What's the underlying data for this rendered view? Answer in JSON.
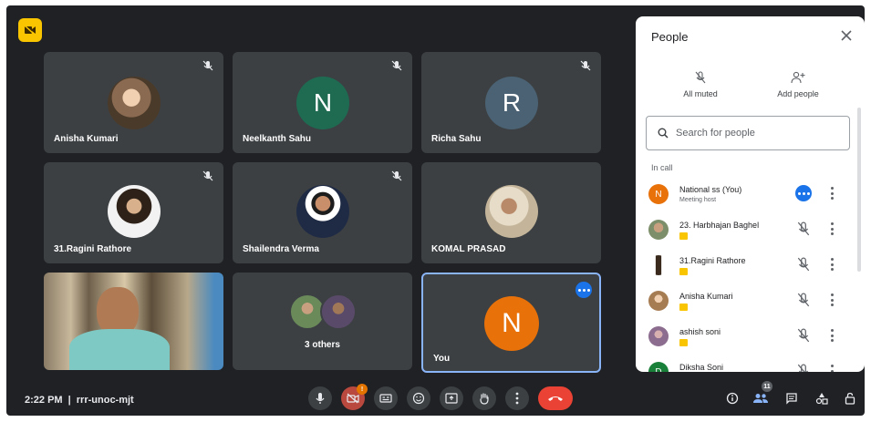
{
  "meeting": {
    "time": "2:22 PM",
    "separator": "|",
    "code": "rrr-unoc-mjt"
  },
  "tiles": [
    {
      "name": "Anisha Kumari",
      "avatar": "photo",
      "muted": true
    },
    {
      "name": "Neelkanth Sahu",
      "avatar": "letter",
      "initial": "N",
      "color": "#1e6b52",
      "muted": true
    },
    {
      "name": "Richa Sahu",
      "avatar": "letter",
      "initial": "R",
      "color": "#4a6273",
      "muted": true
    },
    {
      "name": "31.Ragini Rathore",
      "avatar": "photo",
      "muted": true
    },
    {
      "name": "Shailendra Verma",
      "avatar": "photo",
      "muted": true
    },
    {
      "name": "KOMAL PRASAD",
      "avatar": "photo",
      "muted": false
    },
    {
      "name": "",
      "avatar": "video",
      "muted": false
    },
    {
      "name": "3 others",
      "avatar": "group",
      "muted": false
    },
    {
      "name": "You",
      "avatar": "letter",
      "initial": "N",
      "color": "#e8710a",
      "muted": false,
      "selected": true
    }
  ],
  "controls": {
    "buttons": [
      "mic-icon",
      "camera-off-icon",
      "captions-icon",
      "emoji-icon",
      "present-icon",
      "raise-hand-icon",
      "more-vert-icon",
      "end-call-icon"
    ],
    "camera_badge": "!",
    "participant_count": "11",
    "right_icons": [
      "info-icon",
      "people-icon",
      "chat-icon",
      "activities-icon",
      "lock-icon"
    ]
  },
  "people_panel": {
    "title": "People",
    "actions": [
      {
        "label": "All muted",
        "icon": "mic-off-icon"
      },
      {
        "label": "Add people",
        "icon": "add-person-icon"
      }
    ],
    "search_placeholder": "Search for people",
    "section_label": "In call",
    "participants": [
      {
        "name": "National ss (You)",
        "subtitle": "Meeting host",
        "initial": "N",
        "color": "#e8710a",
        "status": "host-options"
      },
      {
        "name": "23. Harbhajan Baghel",
        "subtitle": "",
        "color": "#7d8f6a",
        "status": "muted"
      },
      {
        "name": "31.Ragini Rathore",
        "subtitle": "",
        "color": "#5a4a3a",
        "status": "muted"
      },
      {
        "name": "Anisha Kumari",
        "subtitle": "",
        "color": "#a67c52",
        "status": "muted"
      },
      {
        "name": "ashish soni",
        "subtitle": "",
        "color": "#8c6d8f",
        "status": "muted"
      },
      {
        "name": "Diksha Soni",
        "subtitle": "",
        "initial": "D",
        "color": "#188038",
        "status": "muted"
      }
    ]
  }
}
